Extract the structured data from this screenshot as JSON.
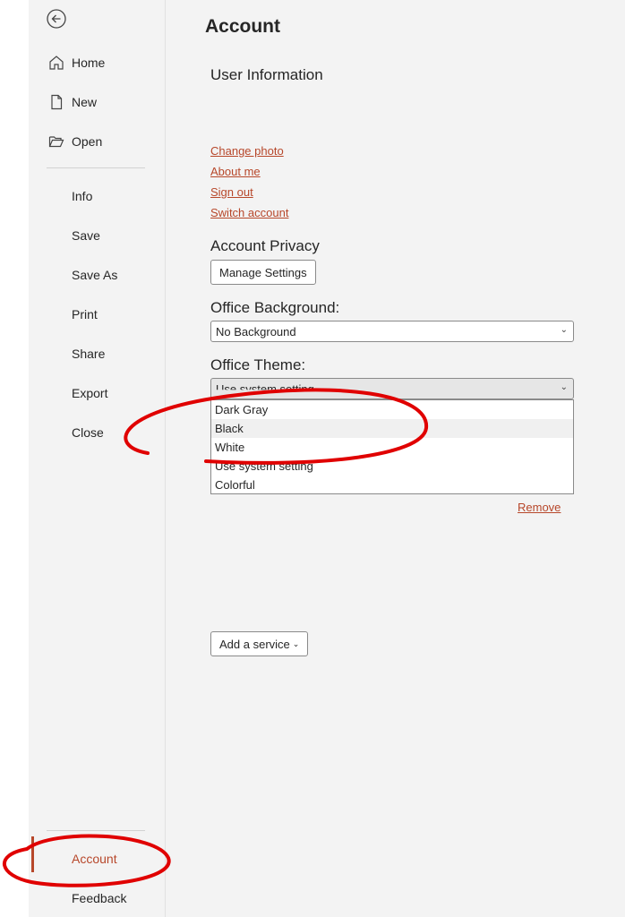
{
  "sidebar": {
    "items_top": [
      {
        "label": "Home",
        "icon": "home-icon"
      },
      {
        "label": "New",
        "icon": "new-document-icon"
      },
      {
        "label": "Open",
        "icon": "folder-open-icon"
      }
    ],
    "items_mid": [
      "Info",
      "Save",
      "Save As",
      "Print",
      "Share",
      "Export",
      "Close"
    ],
    "account_label": "Account",
    "feedback_label": "Feedback"
  },
  "main": {
    "title": "Account",
    "user_info_heading": "User Information",
    "links": [
      "Change photo",
      "About me",
      "Sign out",
      "Switch account"
    ],
    "privacy_heading": "Account Privacy",
    "manage_settings": "Manage Settings",
    "background_heading": "Office Background:",
    "background_value": "No Background",
    "theme_heading": "Office Theme:",
    "theme_value": "Use system setting",
    "theme_options": [
      "Dark Gray",
      "Black",
      "White",
      "Use system setting",
      "Colorful"
    ],
    "remove_label": "Remove",
    "add_service_label": "Add a service"
  },
  "colors": {
    "accent": "#b7472a",
    "annotation": "#e00000",
    "panel": "#f3f3f3"
  }
}
